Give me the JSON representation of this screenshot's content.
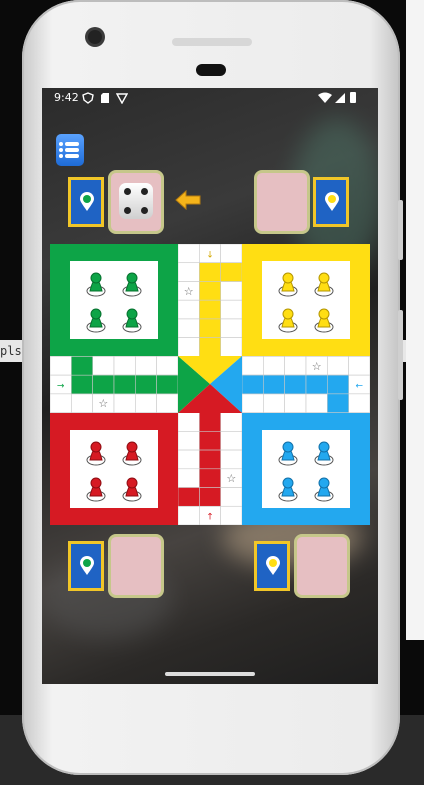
{
  "status_bar": {
    "time": "9:42"
  },
  "background_window": {
    "left_label_text": "pls"
  },
  "game": {
    "title": "",
    "menu_icon": "list-icon",
    "colors": {
      "green": "#0da447",
      "yellow": "#ffde13",
      "red": "#d61a23",
      "blue": "#23a8ef",
      "center_blue": "#1f63c4",
      "frame_gold": "#f1c628",
      "face_card": "#e6bfc2"
    },
    "players": [
      {
        "seat": "top-left",
        "color": "green",
        "has_dice": true
      },
      {
        "seat": "top-right",
        "color": "yellow",
        "has_dice": false
      },
      {
        "seat": "bottom-left",
        "color": "green",
        "has_dice": false
      },
      {
        "seat": "bottom-right",
        "color": "yellow",
        "has_dice": false
      }
    ],
    "dice": {
      "value": 4
    },
    "turn_indicator_icon": "arrow-left-icon",
    "safe_square_symbol": "☆",
    "entry_arrows": {
      "green": "→",
      "yellow": "↓",
      "blue": "←",
      "red": "↑"
    },
    "tokens": {
      "green": 4,
      "yellow": 4,
      "red": 4,
      "blue": 4
    }
  }
}
